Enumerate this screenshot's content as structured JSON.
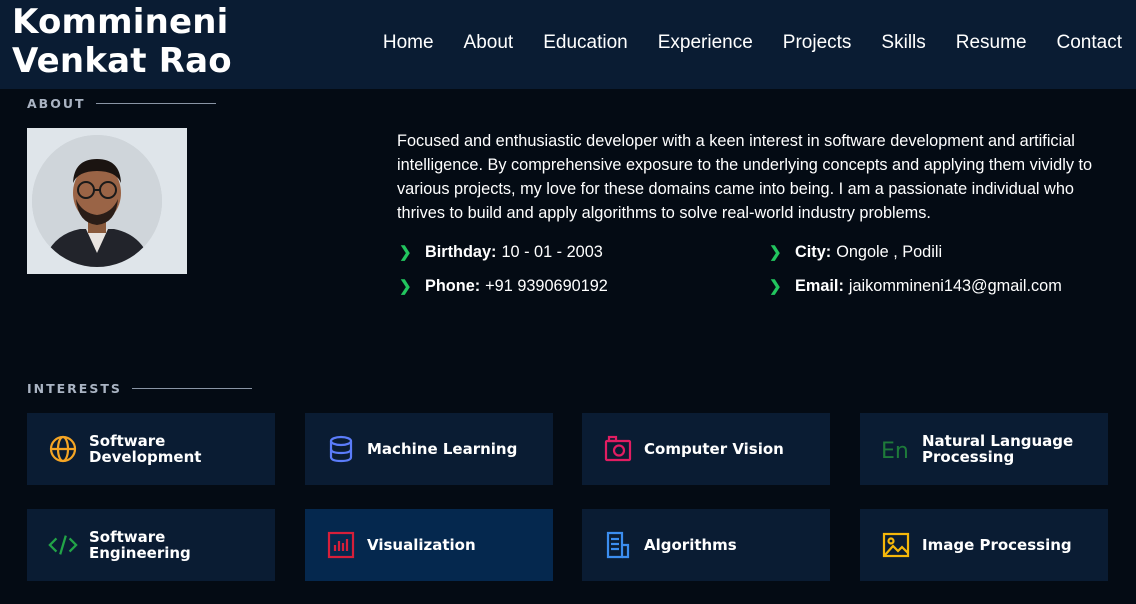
{
  "brand": {
    "line1": "Kommineni",
    "line2": "Venkat Rao"
  },
  "nav": [
    "Home",
    "About",
    "Education",
    "Experience",
    "Projects",
    "Skills",
    "Resume",
    "Contact"
  ],
  "about": {
    "title": "ABOUT",
    "description": "Focused and enthusiastic developer with a keen interest in software development and artificial intelligence. By comprehensive exposure to the underlying concepts and applying them vividly to various projects, my love for these domains came into being. I am a passionate individual who thrives to build and apply algorithms to solve real-world industry problems.",
    "birthday_label": "Birthday:",
    "birthday": "10 - 01 - 2003",
    "city_label": "City:",
    "city": "Ongole , Podili",
    "phone_label": "Phone:",
    "phone": "+91 9390690192",
    "email_label": "Email:",
    "email": "jaikommineni143@gmail.com"
  },
  "interests": {
    "title": "INTERESTS",
    "items": [
      {
        "label": "Software Development",
        "icon": "globe-icon",
        "color": "#f5a524"
      },
      {
        "label": "Machine Learning",
        "icon": "database-icon",
        "color": "#5b7cfa"
      },
      {
        "label": "Computer Vision",
        "icon": "camera-icon",
        "color": "#e11d62"
      },
      {
        "label": "Natural Language Processing",
        "icon": "language-icon",
        "color": "#1e7a3a"
      },
      {
        "label": "Software Engineering",
        "icon": "code-icon",
        "color": "#22a447"
      },
      {
        "label": "Visualization",
        "icon": "bar-chart-icon",
        "color": "#d61f3a"
      },
      {
        "label": "Algorithms",
        "icon": "document-icon",
        "color": "#3b8df0"
      },
      {
        "label": "Image Processing",
        "icon": "image-icon",
        "color": "#f5b70a"
      }
    ]
  },
  "colors": {
    "bullet": "#22c55e",
    "header_bg": "#0a1c33",
    "page_bg": "#040b14"
  }
}
